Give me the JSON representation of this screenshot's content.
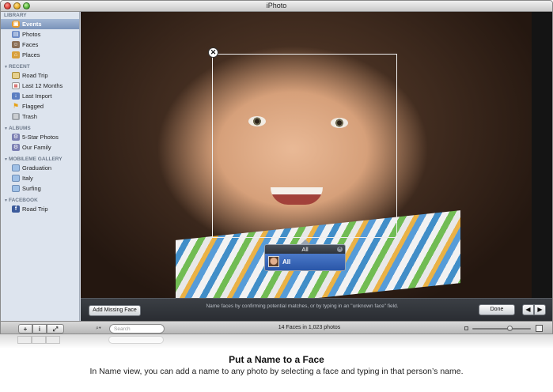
{
  "window": {
    "title": "iPhoto"
  },
  "sidebar": {
    "library": {
      "header": "LIBRARY",
      "items": [
        {
          "label": "Events",
          "icon": "events-icon",
          "selected": true
        },
        {
          "label": "Photos",
          "icon": "photos-icon"
        },
        {
          "label": "Faces",
          "icon": "faces-icon"
        },
        {
          "label": "Places",
          "icon": "places-icon"
        }
      ]
    },
    "recent": {
      "header": "RECENT",
      "items": [
        {
          "label": "Road Trip",
          "icon": "event-thumbnail-icon"
        },
        {
          "label": "Last 12 Months",
          "icon": "calendar-icon"
        },
        {
          "label": "Last Import",
          "icon": "import-icon"
        },
        {
          "label": "Flagged",
          "icon": "flag-icon"
        },
        {
          "label": "Trash",
          "icon": "trash-icon"
        }
      ]
    },
    "albums": {
      "header": "ALBUMS",
      "items": [
        {
          "label": "5-Star Photos",
          "icon": "smart-album-icon"
        },
        {
          "label": "Our Family",
          "icon": "smart-album-icon"
        }
      ]
    },
    "mobileme": {
      "header": "MOBILEME GALLERY",
      "items": [
        {
          "label": "Graduation",
          "icon": "cloud-icon"
        },
        {
          "label": "Italy",
          "icon": "cloud-icon"
        },
        {
          "label": "Surfing",
          "icon": "cloud-icon"
        }
      ]
    },
    "facebook": {
      "header": "FACEBOOK",
      "items": [
        {
          "label": "Road Trip",
          "icon": "facebook-icon"
        }
      ]
    }
  },
  "viewer": {
    "name_popup": {
      "header": "All",
      "suggestion": "All"
    }
  },
  "faces_bar": {
    "add_missing_label": "Add Missing Face",
    "hint": "Name faces by confirming potential matches, or by typing in an \"unknown face\" field.",
    "done_label": "Done",
    "prev_icon": "left-arrow-icon",
    "next_icon": "right-arrow-icon"
  },
  "bottom_bar": {
    "search_placeholder": "Search",
    "count_text": "14 Faces in 1,023 photos",
    "zoom_level": 0.65
  },
  "caption": {
    "title": "Put a Name to a Face",
    "body": "In Name view, you can add a name to any photo by selecting a face and typing in that person’s name."
  },
  "colors": {
    "selection": "#7a93ba",
    "sidebar_bg": "#dde4ee",
    "toolbar_dark": "#2a2d32",
    "popup_highlight": "#2a56a8"
  }
}
